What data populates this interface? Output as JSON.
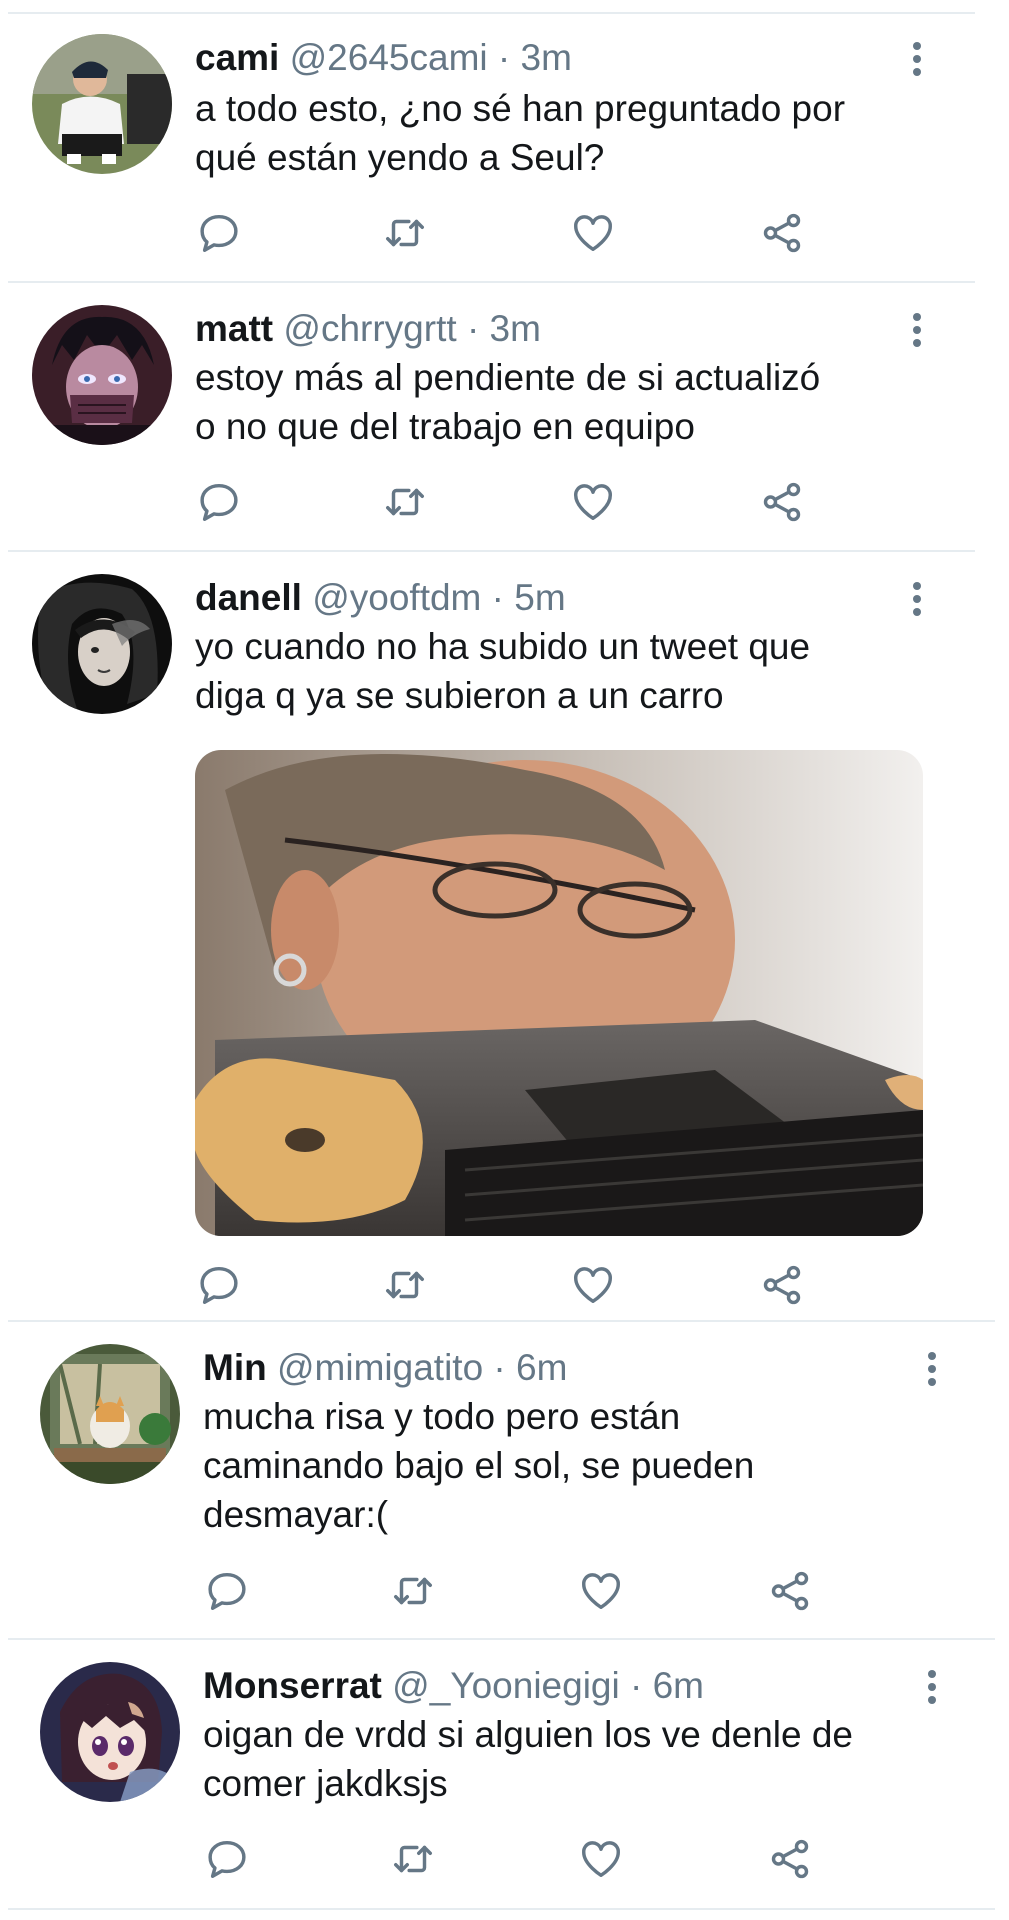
{
  "colors": {
    "text": "#14171a",
    "secondary": "#657786",
    "divider": "#e6ecf0"
  },
  "tweets": [
    {
      "name": "cami",
      "handle": "@2645cami",
      "separator": "·",
      "time": "3m",
      "lines": [
        "a todo esto, ¿no sé han preguntado por",
        "qué están yendo a Seul?"
      ],
      "avatar_icon": "avatar-photo-person"
    },
    {
      "name": "matt",
      "handle": "@chrrygrtt",
      "separator": "·",
      "time": "3m",
      "lines": [
        "estoy más al pendiente de si actualizó",
        "o no que del trabajo en equipo"
      ],
      "avatar_icon": "avatar-anime-character"
    },
    {
      "name": "danell",
      "handle": "@yooftdm",
      "separator": "·",
      "time": "5m",
      "lines": [
        "yo cuando no ha subido un tweet que",
        "diga q ya se subieron a un carro"
      ],
      "avatar_icon": "avatar-dark-artwork",
      "media_icon": "meme-photo-laptop-bite"
    },
    {
      "name": "Min",
      "handle": "@mimigatito",
      "separator": "·",
      "time": "6m",
      "lines": [
        "mucha risa y todo pero están",
        "caminando bajo el sol, se pueden",
        "desmayar:("
      ],
      "avatar_icon": "avatar-cat-window"
    },
    {
      "name": "Monserrat",
      "handle": "@_Yooniegigi",
      "separator": "·",
      "time": "6m",
      "lines": [
        "oigan de vrdd si alguien los ve denle de",
        "comer jakdksjs"
      ],
      "avatar_icon": "avatar-anime-girl"
    }
  ],
  "action_icons": [
    "reply-icon",
    "retweet-icon",
    "like-icon",
    "share-icon"
  ]
}
